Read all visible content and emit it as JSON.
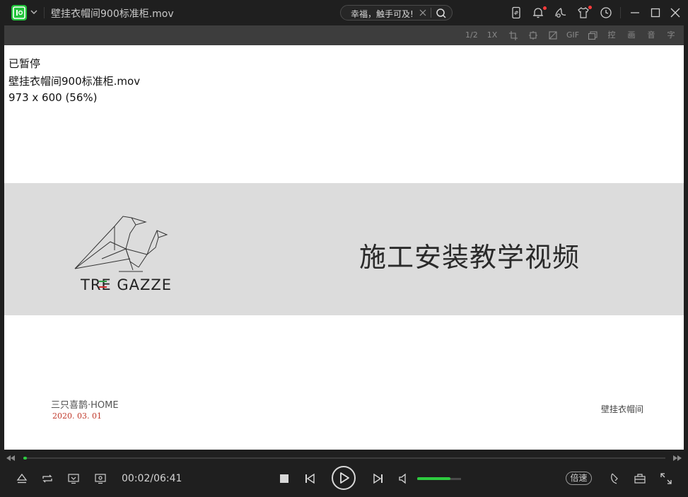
{
  "window": {
    "title": "壁挂衣帽间900标准柜.mov",
    "search_text": "幸福，触手可及!",
    "app_logo": "iqiyi-logo-icon",
    "top_icons": [
      "phone-sync-icon",
      "notification-bell-icon",
      "skin-palette-icon",
      "tshirt-theme-icon",
      "history-clock-icon"
    ],
    "window_controls": [
      "minimize-icon",
      "maximize-icon",
      "close-icon"
    ]
  },
  "toolbar": {
    "items": [
      "1/2",
      "1X",
      "crop-icon",
      "fit-icon",
      "rotate-icon",
      "GIF",
      "layers-icon",
      "控",
      "画",
      "音",
      "字"
    ]
  },
  "video": {
    "osd": {
      "status": "已暂停",
      "filename": "壁挂衣帽间900标准柜.mov",
      "resolution": "973 x 600 (56%)"
    },
    "brand": "TRE GAZZE",
    "headline": "施工安装教学视频",
    "company": "三只喜鹊·HOME",
    "date": "2020. 03. 01",
    "corner_label": "壁挂衣帽间",
    "colors": {
      "band": "#dcdcdc",
      "flag_green": "#2e9e44",
      "flag_red": "#d12d2d"
    }
  },
  "player": {
    "current_time": "00:02",
    "total_time": "06:41",
    "timecode": "00:02/06:41",
    "progress": 0.005,
    "volume": 0.75,
    "speed_label": "倍速",
    "accent_color": "#2ecc40",
    "left_buttons": [
      "eject-icon",
      "loop-icon",
      "cast-icon",
      "screen-capture-icon"
    ],
    "center_buttons": [
      "stop-icon",
      "previous-icon",
      "play-icon",
      "next-icon",
      "volume-icon"
    ],
    "right_buttons": [
      "bell-icon",
      "toolbox-icon",
      "fullscreen-icon"
    ]
  }
}
